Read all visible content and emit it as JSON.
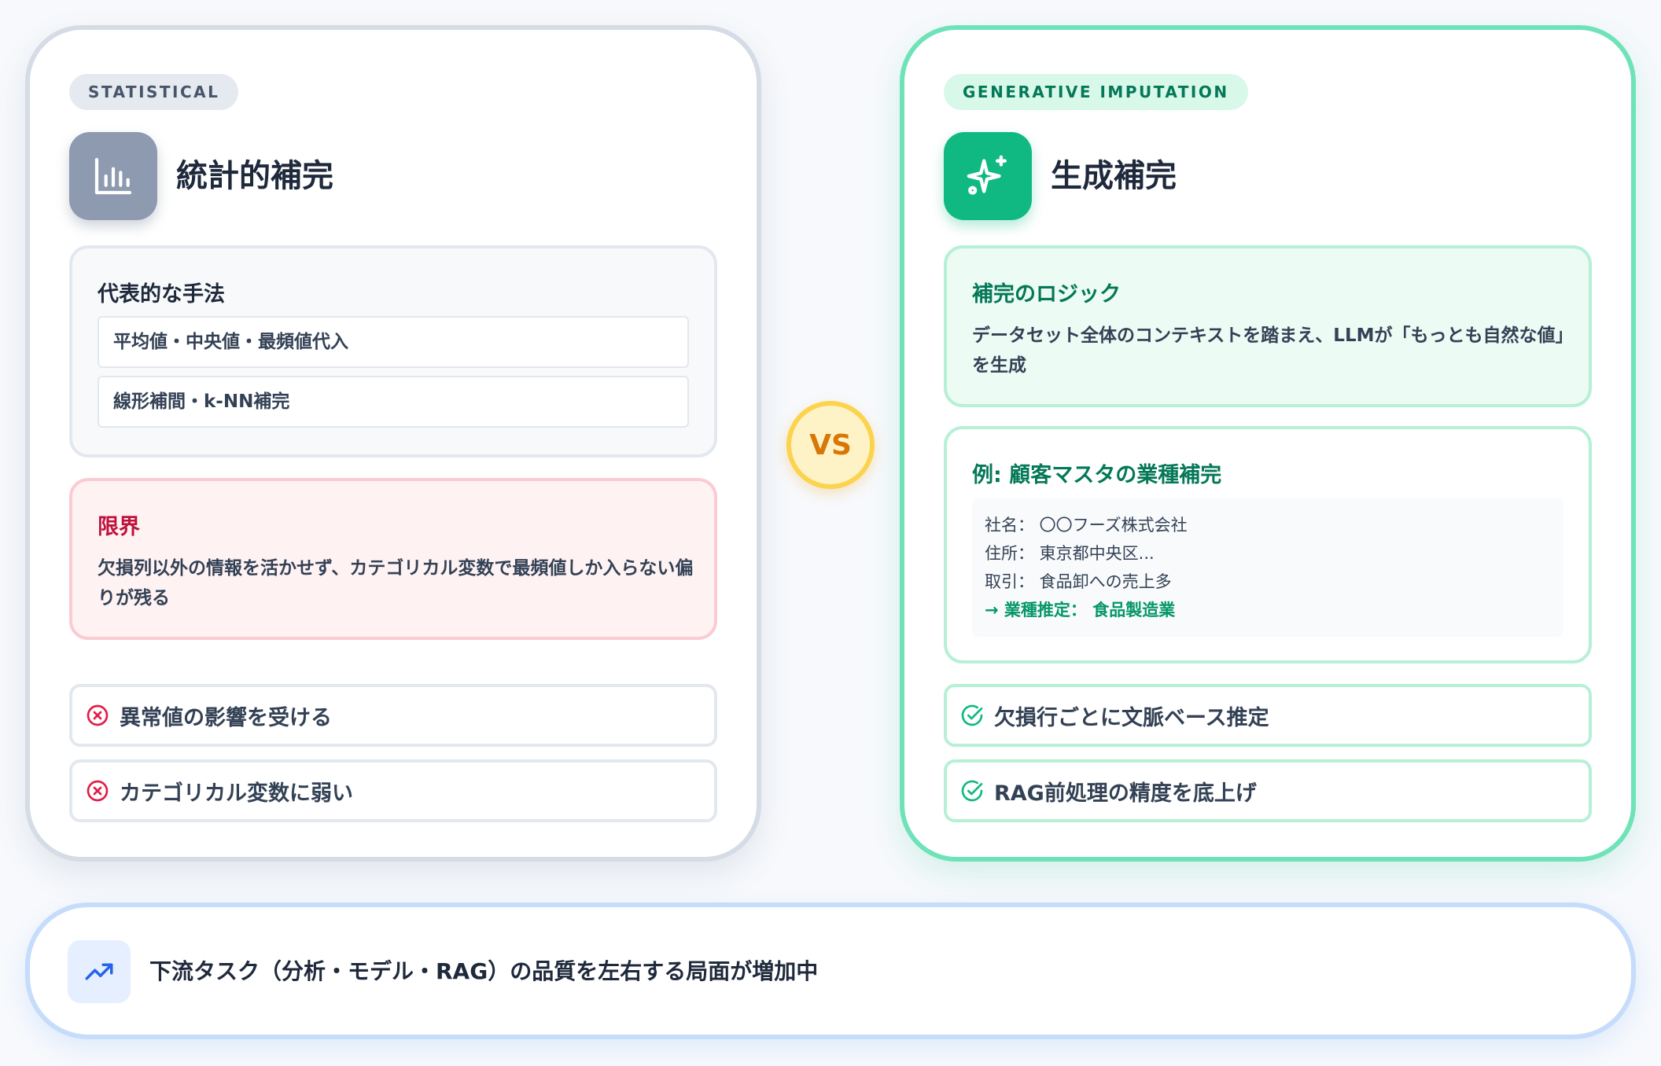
{
  "statistical": {
    "badge": "STATISTICAL",
    "icon": "bar-chart-icon",
    "title": "統計的補完",
    "methods": {
      "heading": "代表的な手法",
      "items": [
        "平均値・中央値・最頻値代入",
        "線形補間・k-NN補完"
      ]
    },
    "limit": {
      "heading": "限界",
      "text": "欠損列以外の情報を活かせず、カテゴリカル変数で最頻値しか入らない偏りが残る"
    },
    "cons": [
      "異常値の影響を受ける",
      "カテゴリカル変数に弱い"
    ]
  },
  "vs_label": "VS",
  "generative": {
    "badge": "GENERATIVE IMPUTATION",
    "icon": "sparkles-icon",
    "title": "生成補完",
    "logic": {
      "heading": "補完のロジック",
      "text": "データセット全体のコンテキストを踏まえ、LLMが「もっとも自然な値」を生成"
    },
    "example": {
      "heading": "例: 顧客マスタの業種補完",
      "lines": [
        "社名： 〇〇フーズ株式会社",
        "住所： 東京都中央区...",
        "取引： 食品卸への売上多"
      ],
      "result": "→ 業種推定： 食品製造業"
    },
    "pros": [
      "欠損行ごとに文脈ベース推定",
      "RAG前処理の精度を底上げ"
    ]
  },
  "footer": {
    "icon": "trending-up-icon",
    "text": "下流タスク（分析・モデル・RAG）の品質を左右する局面が増加中"
  },
  "colors": {
    "statistical_accent": "#8d9ab0",
    "generative_accent": "#10b981",
    "limit_accent": "#be123c",
    "vs_accent": "#d97706",
    "footer_accent": "#3b82f6"
  }
}
